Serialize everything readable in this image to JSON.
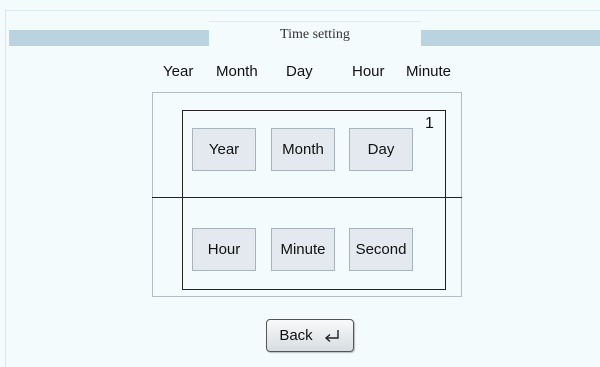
{
  "header": {
    "title": "Time setting"
  },
  "columns": {
    "year": "Year",
    "month": "Month",
    "day": "Day",
    "hour": "Hour",
    "minute": "Minute"
  },
  "panel": {
    "page_number": "1",
    "date_buttons": {
      "year": "Year",
      "month": "Month",
      "day": "Day"
    },
    "time_buttons": {
      "hour": "Hour",
      "minute": "Minute",
      "second": "Second"
    }
  },
  "footer": {
    "back_label": "Back",
    "back_icon": "enter-return-icon"
  }
}
